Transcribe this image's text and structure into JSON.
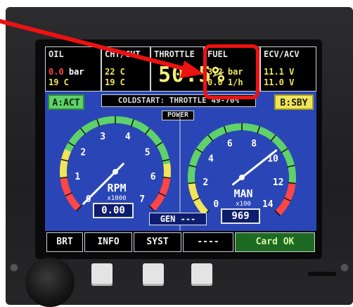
{
  "oil": {
    "header": "OIL",
    "line1_value": "0.0",
    "line1_unit": "bar",
    "line2": "19 C"
  },
  "temp": {
    "header": "CHT/CHT",
    "line1": "22 C",
    "line2": "19 C"
  },
  "throttle": {
    "header": "THROTTLE",
    "value": "50.5%"
  },
  "fuel": {
    "header": "FUEL",
    "line1": "3.2 bar",
    "line2": "0.0 1/h"
  },
  "ecv": {
    "header": "ECV/ACV",
    "line1": "11.1 V",
    "line2": "11.0 V"
  },
  "mode_left": "A:ACT",
  "mode_right": "B:SBY",
  "banner": "COLDSTART: THROTTLE 49-70%",
  "power_label": "POWER",
  "rpm_gauge": {
    "label": "RPM",
    "scale": "x1000",
    "ticks": [
      "0",
      "1",
      "2",
      "3",
      "4",
      "5",
      "6",
      "7"
    ],
    "readout": "0.00",
    "needle_value": 0
  },
  "man_gauge": {
    "label": "MAN",
    "scale": "x100",
    "ticks": [
      "0",
      "2",
      "4",
      "6",
      "8",
      "10",
      "12",
      "14"
    ],
    "readout": "969",
    "needle_value": 9.69
  },
  "gen_label": "GEN ---",
  "softkeys": [
    "BRT",
    "INFO",
    "SYST",
    "----",
    "Card OK"
  ],
  "colors": {
    "screen_bg": "#2a46b6",
    "green": "#5fd16a",
    "yellow": "#f0e458",
    "red": "#ff4545",
    "callout": "#ee1111"
  }
}
